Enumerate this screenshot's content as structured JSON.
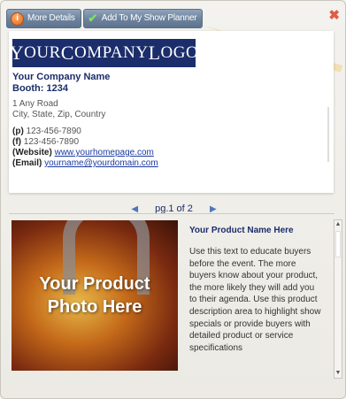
{
  "toolbar": {
    "more_details_label": "More Details",
    "add_planner_label": "Add To My Show Planner",
    "info_icon": "i",
    "check_icon": "✔",
    "close_icon": "✖"
  },
  "card": {
    "logo_first": "Y",
    "logo_text_a": "OUR ",
    "logo_first2": "C",
    "logo_text_b": "OMPANY ",
    "logo_first3": "L",
    "logo_text_c": "OGO",
    "company_name": "Your Company Name",
    "booth": "Booth: 1234",
    "address_line1": "1 Any Road",
    "address_line2": "City, State, Zip, Country",
    "phone_label": "(p)",
    "phone": "123-456-7890",
    "fax_label": "(f)",
    "fax": "123-456-7890",
    "website_label": "(Website)",
    "website": "www.yourhomepage.com",
    "email_label": "(Email)",
    "email": "yourname@yourdomain.com"
  },
  "pager": {
    "prev_icon": "◀",
    "text": "pg.1 of 2",
    "next_icon": "▶"
  },
  "product": {
    "photo_line1": "Your Product",
    "photo_line2": "Photo Here",
    "title": "Your Product Name Here",
    "description": "Use this text to educate buyers before the event. The more buyers know about your product, the more likely they will add you to their agenda. Use this product description area to highlight show specials or provide buyers with detailed product or service specifications"
  },
  "colors": {
    "accent": "#1b2d6b",
    "button": "#6c829c",
    "close": "#e35b47"
  }
}
